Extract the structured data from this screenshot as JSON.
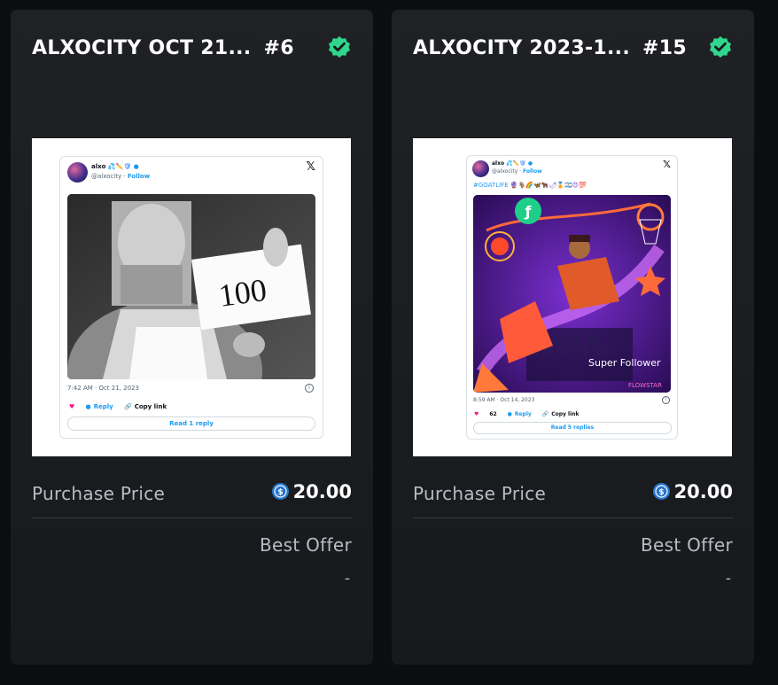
{
  "cards": [
    {
      "title": "ALXOCITY OCT 21...",
      "number": "#6",
      "tweet": {
        "name": "alxo",
        "handle": "@alxocity",
        "follow": "Follow",
        "media_text": "100",
        "time": "7:42 AM · Oct 21, 2023",
        "reply": "Reply",
        "copy": "Copy link",
        "read": "Read 1 reply"
      },
      "purchase_label": "Purchase Price",
      "price": "20.00",
      "best_offer_label": "Best Offer",
      "best_offer_value": "-"
    },
    {
      "title": "ALXOCITY 2023-1...",
      "number": "#15",
      "tweet": {
        "name": "alxo",
        "handle": "@alxocity",
        "follow": "Follow",
        "hashtag": "#GOATLIFE",
        "media_text": "Super Follower",
        "time": "8:59 AM · Oct 14, 2023",
        "likes": "62",
        "reply": "Reply",
        "copy": "Copy link",
        "read": "Read 5 replies"
      },
      "purchase_label": "Purchase Price",
      "price": "20.00",
      "best_offer_label": "Best Offer",
      "best_offer_value": "-"
    }
  ],
  "colors": {
    "background": "#0b0d10",
    "card": "#1c1e22",
    "verified": "#2fd68c",
    "usdc": "#2775ca"
  },
  "icons": [
    "verified-check-icon",
    "usdc-coin-icon",
    "x-logo-icon",
    "heart-icon",
    "reply-icon",
    "link-icon",
    "info-icon"
  ]
}
